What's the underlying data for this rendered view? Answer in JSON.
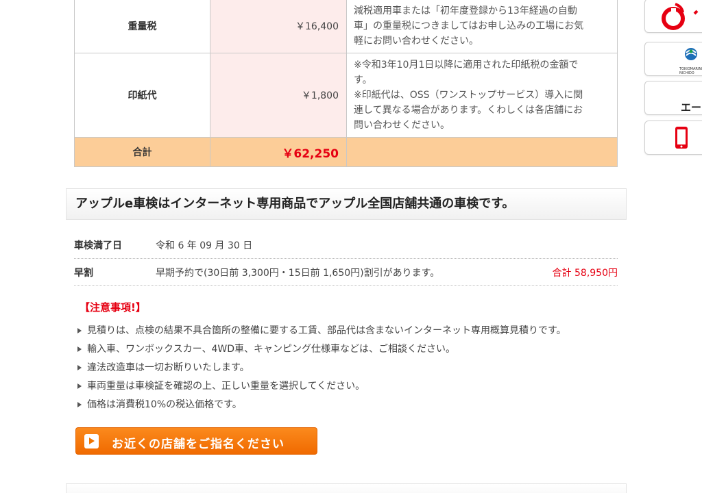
{
  "fee_table": {
    "rows": [
      {
        "label": "重量税",
        "price": "￥16,400",
        "note": "減税適用車または「初年度登録から13年経過の自動\n車」の重量税につきましてはお申し込みの工場にお気\n軽にお問い合わせください。"
      },
      {
        "label": "印紙代",
        "price": "￥1,800",
        "note": "※令和3年10月1日以降に適用された印紙税の金額で\nす。\n※印紙代は、OSS（ワンストップサービス）導入に関\n連して異なる場合があります。くわしくは各店舗にお\n問い合わせください。"
      }
    ],
    "total": {
      "label": "合計",
      "price": "￥62,250"
    }
  },
  "side_badges": {
    "b3_text": "エー",
    "b2_small": "TOKIOMARINE\nNICHIDO"
  },
  "section": {
    "title": "アップルe車検はインターネット専用商品でアップル全国店舗共通の車検です。"
  },
  "info": {
    "expiry_label": "車検満了日",
    "expiry_value": "令和 6 年 09 月 30 日",
    "early_label": "早割",
    "early_value": "早期予約で(30日前 3,300円・15日前 1,650円)割引があります。",
    "early_total": "合計 58,950円"
  },
  "notice": {
    "title": "【注意事項!】",
    "items": [
      "見積りは、点検の結果不具合箇所の整備に要する工賃、部品代は含まないインターネット専用概算見積りです。",
      "輸入車、ワンボックスカー、4WD車、キャンピング仕様車などは、ご相談ください。",
      "違法改造車は一切お断りいたします。",
      "車両重量は車検証を確認の上、正しい重量を選択してください。",
      "価格は消費税10%の税込価格です。"
    ]
  },
  "cta": {
    "label": "お近くの店舗をご指名ください"
  },
  "colors": {
    "accent_red": "#e60012",
    "orange": "#f17400",
    "total_row_bg": "#fccd98",
    "price_cell_bg": "#fdeceb"
  }
}
